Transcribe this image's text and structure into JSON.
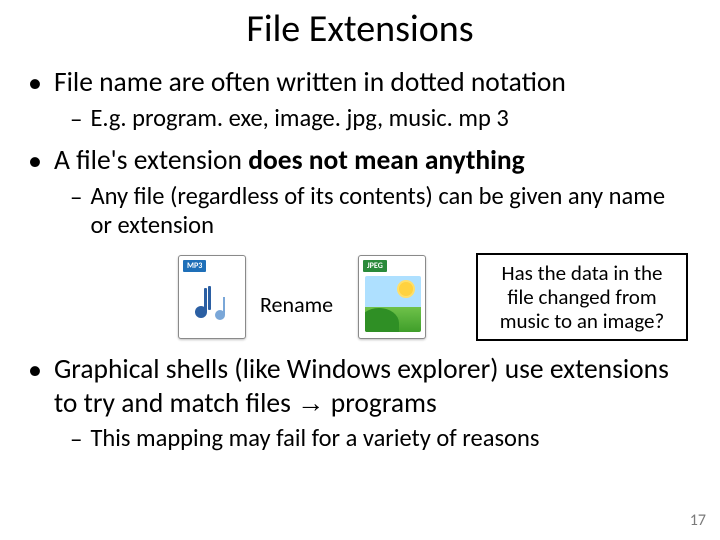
{
  "title": "File Extensions",
  "bullets": {
    "b1": {
      "text_a": "File name are often written in dotted notation",
      "sub": "E.g. program. exe, image. jpg, music. mp 3"
    },
    "b2": {
      "text_a": "A file's ",
      "text_b": "extension",
      "text_c": " does not mean anything",
      "sub": "Any file (regardless of its contents) can be given any name or extension"
    },
    "b3": {
      "text_a": "Graphical shells (like Windows explorer) use extensions to try and match files ",
      "arrow": "→",
      "text_b": " programs",
      "sub": "This mapping may fail for a variety of reasons"
    }
  },
  "illustration": {
    "mp3_tag": "MP3",
    "jpg_tag": "JPEG",
    "rename": "Rename",
    "callout": "Has the data in the file changed from music to an image?"
  },
  "page_number": "17"
}
